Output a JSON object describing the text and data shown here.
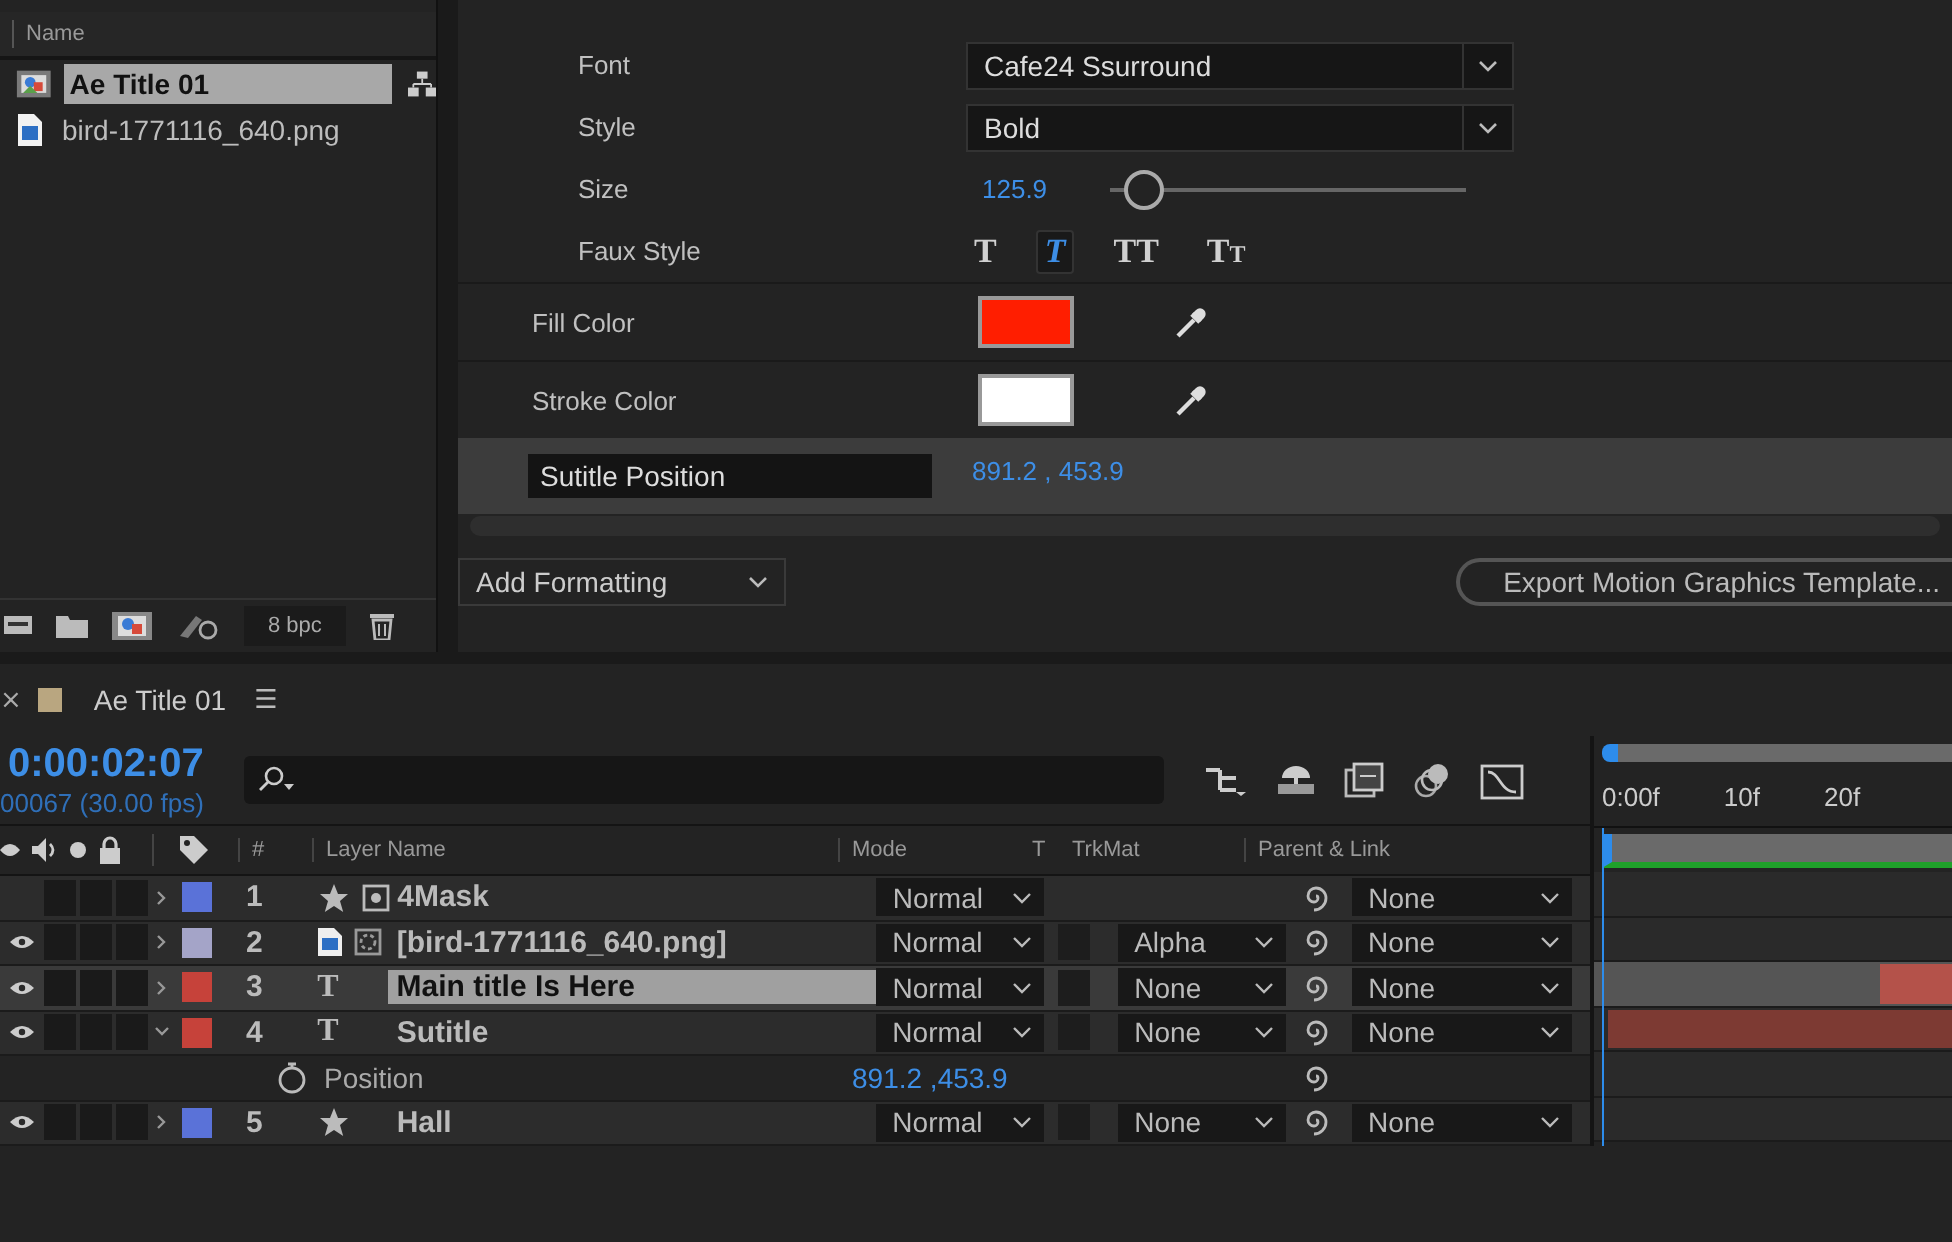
{
  "project": {
    "column": "Name",
    "items": [
      {
        "name": "Ae Title 01",
        "kind": "composition",
        "selected": true
      },
      {
        "name": "bird-1771116_640.png",
        "kind": "image",
        "selected": false
      }
    ],
    "bit_depth": "8 bpc"
  },
  "essential_graphics": {
    "properties": [
      {
        "label": "Font",
        "kind": "dropdown",
        "value": "Cafe24 Ssurround"
      },
      {
        "label": "Style",
        "kind": "dropdown",
        "value": "Bold"
      },
      {
        "label": "Size",
        "kind": "slider",
        "value": "125.9",
        "level": 0.09
      },
      {
        "label": "Faux Style",
        "kind": "faux",
        "options": [
          {
            "label": "T",
            "kind": "bold",
            "selected": false
          },
          {
            "label": "T",
            "kind": "italic",
            "selected": true
          },
          {
            "label": "TT",
            "kind": "caps",
            "selected": false
          },
          {
            "label": "Tt",
            "kind": "smallcaps",
            "selected": false
          }
        ]
      },
      {
        "label": "Fill Color",
        "kind": "color",
        "color": "#ff1e00"
      },
      {
        "label": "Stroke Color",
        "kind": "color",
        "color": "#ffffff"
      }
    ],
    "position": {
      "name": "Sutitle Position",
      "value": "891.2 , 453.9"
    },
    "add_formatting": "Add Formatting",
    "export_button": "Export Motion Graphics Template..."
  },
  "timeline": {
    "tab": {
      "close": "×",
      "title": "Ae Title 01",
      "menu": "☰"
    },
    "timecode": "0:00:02:07",
    "frame_info": "00067 (30.00 fps)",
    "columns": {
      "number": "#",
      "layer_name": "Layer Name",
      "mode": "Mode",
      "t": "T",
      "trkmat": "TrkMat",
      "parent": "Parent & Link"
    },
    "ruler": [
      "0:00f",
      "10f",
      "20f"
    ],
    "layers": [
      {
        "number": "1",
        "name": "4Mask",
        "kind": "shape",
        "masked": true,
        "collapsed": false,
        "visible": false,
        "expanded": false,
        "selected": false,
        "color": "#5a72d8",
        "mode": "Normal",
        "parent": "None"
      },
      {
        "number": "2",
        "name": "[bird-1771116_640.png]",
        "kind": "image",
        "masked": false,
        "collapsed": true,
        "visible": true,
        "expanded": false,
        "selected": false,
        "color": "#a4a4c8",
        "mode": "Normal",
        "preserve_transparency": false,
        "trkmat": "Alpha",
        "parent": "None"
      },
      {
        "number": "3",
        "name": "Main title Is Here",
        "kind": "text",
        "icon": "T",
        "masked": false,
        "collapsed": false,
        "visible": true,
        "expanded": false,
        "selected": true,
        "color": "#c6423a",
        "mode": "Normal",
        "preserve_transparency": false,
        "trkmat": "None",
        "parent": "None",
        "level": 0.2
      },
      {
        "number": "4",
        "name": "Sutitle",
        "kind": "text",
        "icon": "T",
        "masked": false,
        "collapsed": false,
        "visible": true,
        "expanded": true,
        "selected": false,
        "color": "#c6423a",
        "mode": "Normal",
        "preserve_transparency": false,
        "trkmat": "None",
        "parent": "None",
        "level": 0.96,
        "properties": [
          {
            "name": "Position",
            "value": "891.2 ,453.9"
          }
        ]
      },
      {
        "number": "5",
        "name": "Hall",
        "kind": "shape",
        "masked": false,
        "collapsed": false,
        "visible": true,
        "expanded": false,
        "selected": false,
        "color": "#5a72d8",
        "mode": "Normal",
        "preserve_transparency": false,
        "trkmat": "None",
        "parent": "None"
      }
    ]
  }
}
